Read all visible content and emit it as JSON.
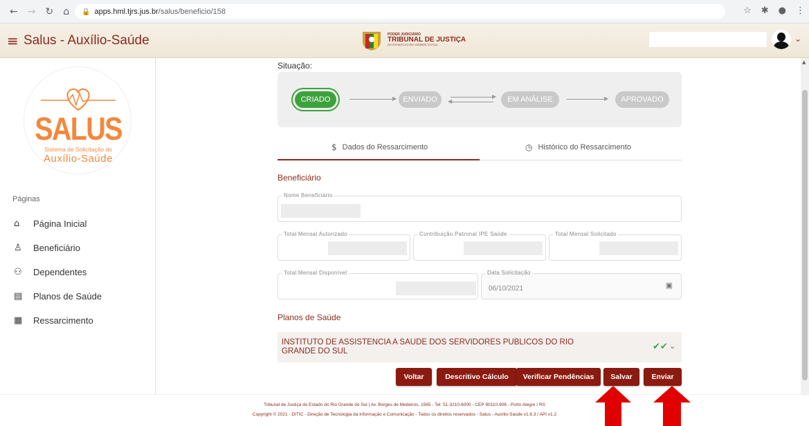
{
  "browser": {
    "url_host": "apps.hml.tjrs.jus.br",
    "url_path": "/salus/beneficio/158"
  },
  "header": {
    "title": "Salus - Auxílio-Saúde",
    "court_small": "PODER JUDICIÁRIO",
    "court_name": "TRIBUNAL DE JUSTIÇA",
    "court_sub": "DO ESTADO DO RIO GRANDE DO SUL"
  },
  "sidebar": {
    "logo_title": "SALUS",
    "logo_subtitle": "Sistema de Solicitação do",
    "logo_aux": "Auxílio-Saúde",
    "pages_label": "Páginas",
    "items": [
      {
        "label": "Página Inicial",
        "icon": "home-icon"
      },
      {
        "label": "Beneficiário",
        "icon": "person-icon"
      },
      {
        "label": "Dependentes",
        "icon": "group-icon"
      },
      {
        "label": "Planos de Saúde",
        "icon": "clipboard-icon"
      },
      {
        "label": "Ressarcimento",
        "icon": "receipt-icon"
      }
    ]
  },
  "status": {
    "label": "Situação:",
    "steps": [
      "CRIADO",
      "ENVIADO",
      "EM ANÁLISE",
      "APROVADO"
    ],
    "active_step": "CRIADO",
    "active_color": "#3ca33c",
    "inactive_color": "#c9c9c9"
  },
  "tabs": {
    "dados": "Dados do Ressarcimento",
    "historico": "Histórico do Ressarcimento",
    "active": "dados"
  },
  "beneficiario": {
    "section": "Beneficiário",
    "nome_label": "Nome Beneficiário",
    "total_autorizado_label": "Total Mensal Autorizado",
    "contribuicao_label": "Contribuição Patronal IPE Saúde",
    "total_solicitado_label": "Total Mensal Solicitado",
    "total_disponivel_label": "Total Mensal Disponível",
    "data_label": "Data Solicitação",
    "data_value": "06/10/2021"
  },
  "planos": {
    "section": "Planos de Saúde",
    "item": "INSTITUTO DE ASSISTENCIA A SAUDE DOS SERVIDORES PUBLICOS DO RIO GRANDE DO SUL"
  },
  "buttons": {
    "voltar": "Voltar",
    "descritivo": "Descritivo Cálculo",
    "verificar": "Verificar Pendências",
    "salvar": "Salvar",
    "enviar": "Enviar"
  },
  "footer": {
    "line1": "Tribunal de Justiça do Estado do Rio Grande do Sul | Av. Borges de Medeiros, 1565 - Tel: 51-3210-6000 - CEP 90110-906 - Porto Alegre / RS",
    "line2": "Copyright © 2021 - DITIC - Direção de Tecnologia da Informação e Comunicação - Todos os direitos reservados - Salus - Auxílio-Saúde v1.6.3 / API v1.2"
  },
  "colors": {
    "brand": "#8b2a1c",
    "button": "#8b1a10",
    "logo_orange": "#f4873c",
    "annotation_arrow": "#e00000"
  }
}
